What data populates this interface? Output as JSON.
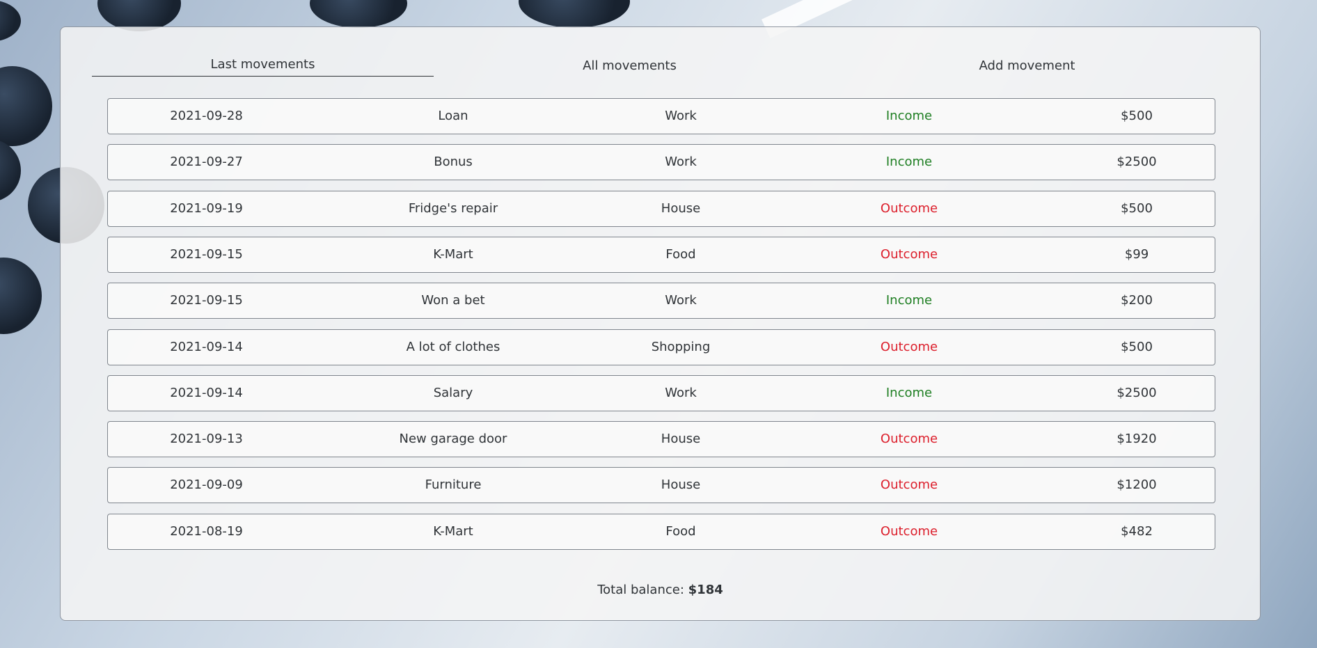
{
  "tabs": {
    "last": "Last movements",
    "all": "All movements",
    "add": "Add movement"
  },
  "movements": [
    {
      "date": "2021-09-28",
      "description": "Loan",
      "category": "Work",
      "type": "Income",
      "amount": "$500"
    },
    {
      "date": "2021-09-27",
      "description": "Bonus",
      "category": "Work",
      "type": "Income",
      "amount": "$2500"
    },
    {
      "date": "2021-09-19",
      "description": "Fridge's repair",
      "category": "House",
      "type": "Outcome",
      "amount": "$500"
    },
    {
      "date": "2021-09-15",
      "description": "K-Mart",
      "category": "Food",
      "type": "Outcome",
      "amount": "$99"
    },
    {
      "date": "2021-09-15",
      "description": "Won a bet",
      "category": "Work",
      "type": "Income",
      "amount": "$200"
    },
    {
      "date": "2021-09-14",
      "description": "A lot of clothes",
      "category": "Shopping",
      "type": "Outcome",
      "amount": "$500"
    },
    {
      "date": "2021-09-14",
      "description": "Salary",
      "category": "Work",
      "type": "Income",
      "amount": "$2500"
    },
    {
      "date": "2021-09-13",
      "description": "New garage door",
      "category": "House",
      "type": "Outcome",
      "amount": "$1920"
    },
    {
      "date": "2021-09-09",
      "description": "Furniture",
      "category": "House",
      "type": "Outcome",
      "amount": "$1200"
    },
    {
      "date": "2021-08-19",
      "description": "K-Mart",
      "category": "Food",
      "type": "Outcome",
      "amount": "$482"
    }
  ],
  "balance": {
    "label": "Total balance:",
    "value": "$184"
  },
  "colors": {
    "income": "#1e7e22",
    "outcome": "#dc1e2b"
  }
}
